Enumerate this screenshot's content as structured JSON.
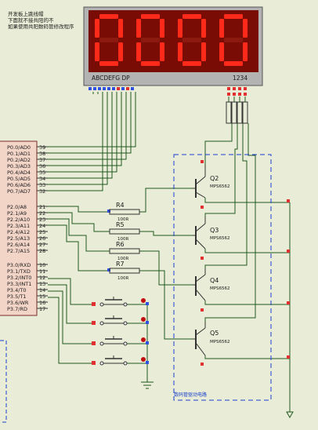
{
  "notes": [
    "开发板上跳线帽",
    "下面就不接共阳的不",
    "如果使用共阳数码管修改程序"
  ],
  "display": {
    "digits": [
      "0",
      "0",
      "0",
      "0"
    ],
    "segment_label": "ABCDEFG DP",
    "digit_label": "1234",
    "segment_color": "#ff2a1a",
    "body_color": "#7a0c06"
  },
  "mcu": {
    "port0": [
      "P0.0/AD0",
      "P0.1/AD1",
      "P0.2/AD2",
      "P0.3/AD3",
      "P0.4/AD4",
      "P0.5/AD5",
      "P0.6/AD6",
      "P0.7/AD7"
    ],
    "port0_pins": [
      "39",
      "38",
      "37",
      "36",
      "35",
      "34",
      "33",
      "32"
    ],
    "port2": [
      "P2.0/A8",
      "P2.1/A9",
      "P2.2/A10",
      "P2.3/A11",
      "P2.4/A12",
      "P2.5/A13",
      "P2.6/A14",
      "P2.7/A15"
    ],
    "port2_pins": [
      "21",
      "22",
      "23",
      "24",
      "25",
      "26",
      "27",
      "28"
    ],
    "port3": [
      "P3.0/RXD",
      "P3.1/TXD",
      "P3.2/INT0",
      "P3.3/INT1",
      "P3.4/T0",
      "P3.5/T1",
      "P3.6/WR",
      "P3.7/RD"
    ],
    "port3_pins": [
      "10",
      "11",
      "12",
      "13",
      "14",
      "15",
      "16",
      "17"
    ]
  },
  "resistors": [
    {
      "name": "R4",
      "value": "100R"
    },
    {
      "name": "R5",
      "value": "100R"
    },
    {
      "name": "R6",
      "value": "100R"
    },
    {
      "name": "R7",
      "value": "100R"
    }
  ],
  "transistors": [
    {
      "name": "Q2",
      "part": "MPS6562"
    },
    {
      "name": "Q3",
      "part": "MPS6562"
    },
    {
      "name": "Q4",
      "part": "MPS6562"
    },
    {
      "name": "Q5",
      "part": "MPS6562"
    }
  ],
  "box_label": "数码管驱动电路",
  "colors": {
    "wire": "#1f5a1f",
    "pin_red": "#e23030",
    "pin_blue": "#3050e0",
    "box": "#1a3fd0"
  }
}
